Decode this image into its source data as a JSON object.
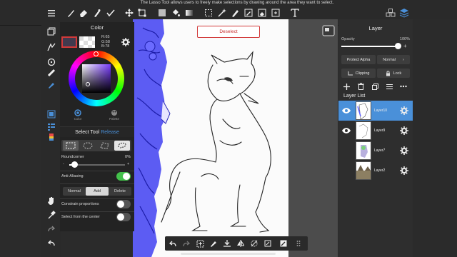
{
  "top_message": "The Lasso Tool allows users to freely make selections by drawing around the area they want to select.",
  "canvas": {
    "deselect_label": "Deselect"
  },
  "color_panel": {
    "title": "Color",
    "rgb": {
      "r": "R:65",
      "g": "G:58",
      "b": "B:78"
    },
    "primary_color": "#413a4e",
    "tabs": [
      {
        "label": "Color"
      },
      {
        "label": "Palette"
      }
    ]
  },
  "select_tool": {
    "title": "Select Tool",
    "release_label": "Release",
    "roundcorner_label": "Roundcorner",
    "roundcorner_value": "0%",
    "minus_label": "-",
    "plus_label": "+",
    "antialias_label": "Anti-Aliasing",
    "antialias_on": true,
    "modes": [
      {
        "label": "Normal"
      },
      {
        "label": "Add",
        "active": true
      },
      {
        "label": "Delete"
      }
    ],
    "constrain_label": "Constrain proportions",
    "center_label": "Select from the center"
  },
  "layer_panel": {
    "title": "Layer",
    "opacity_label": "Opacity",
    "opacity_value": "100%",
    "protect_alpha_label": "Protect Alpha",
    "blend_mode_label": "Normal",
    "clipping_label": "Clipping",
    "lock_label": "Lock",
    "list_title": "Layer List",
    "layers": [
      {
        "name": "Layer10",
        "selected": true
      },
      {
        "name": "Layer9"
      },
      {
        "name": "Layer7"
      },
      {
        "name": "Layer2"
      }
    ]
  },
  "colors": {
    "accent_blue": "#4a90d9",
    "toggle_green": "#43c14b",
    "deselect_red": "#d23a3a"
  },
  "icons": {
    "top_left": [
      "menu-icon",
      "layers-icon",
      "brush-icon",
      "eraser-icon",
      "smudge-icon",
      "lasso-check-icon",
      "move-icon",
      "transform-icon"
    ],
    "top_mid": [
      "fill-color-icon",
      "bucket-icon",
      "gradient-icon",
      "select-rect-icon",
      "magic-wand-icon",
      "pen-select-icon",
      "select-pen-icon",
      "select-eraser-icon",
      "text-icon"
    ],
    "top_right": [
      "material-icon",
      "layer-stack-icon"
    ]
  }
}
